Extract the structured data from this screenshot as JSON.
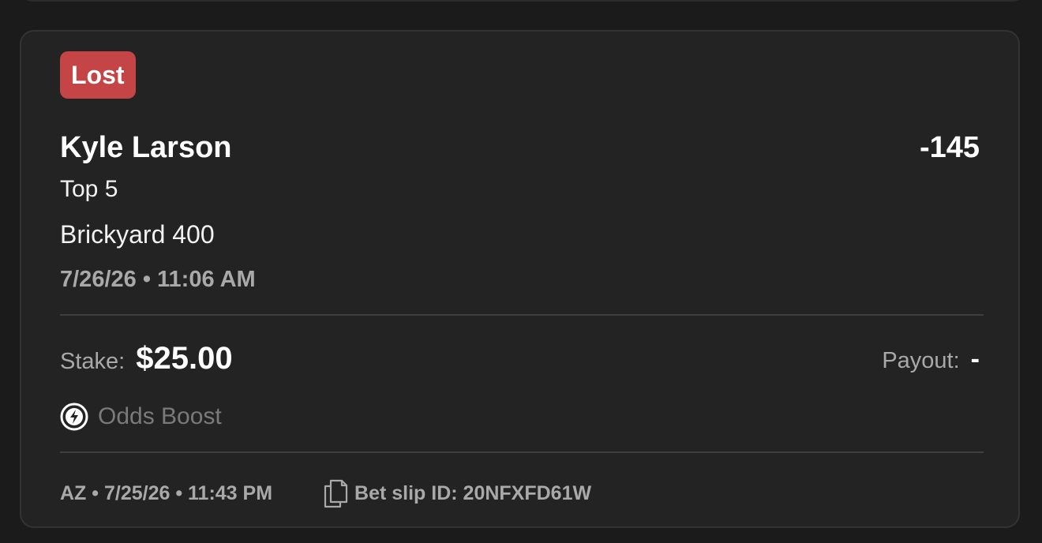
{
  "bet": {
    "status": "Lost",
    "status_color": "#c54546",
    "selection": "Kyle Larson",
    "odds": "-145",
    "market": "Top 5",
    "event": "Brickyard 400",
    "event_time": "7/26/26 • 11:06 AM",
    "stake_label": "Stake:",
    "stake_value": "$25.00",
    "payout_label": "Payout:",
    "payout_value": "-",
    "boost_icon": "lightning-bolt-icon",
    "boost_label": "Odds Boost"
  },
  "footer": {
    "meta": "AZ • 7/25/26 • 11:43 PM",
    "slip_icon": "copy-icon",
    "slip_id": "Bet slip ID: 20NFXFD61W"
  }
}
